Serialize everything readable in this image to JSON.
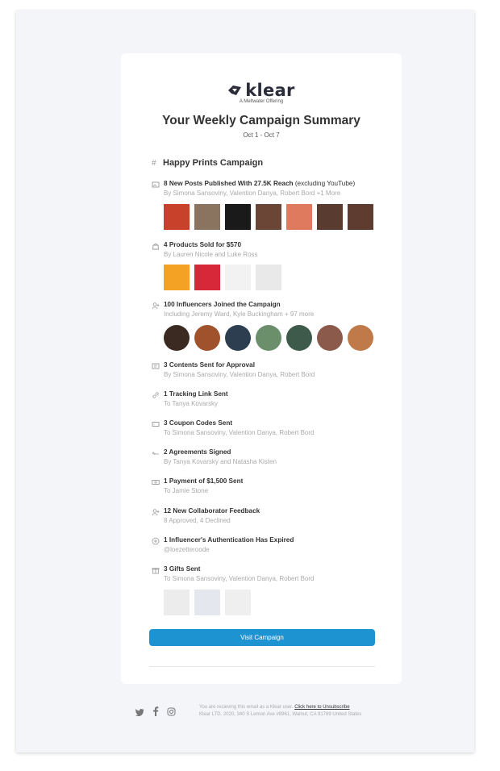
{
  "brand": {
    "name": "klear",
    "tagline": "A Meltwater Offering"
  },
  "email": {
    "title": "Your Weekly Campaign Summary",
    "dates": "Oct 1 - Oct 7"
  },
  "campaign": {
    "name": "Happy Prints Campaign"
  },
  "items": [
    {
      "icon": "image-icon",
      "title": "8 New Posts Published With 27.5K Reach",
      "title_extra": "(excluding YouTube)",
      "subtitle": "By Simona Sansoviny, Valention Danya, Robert Bord +1 More"
    },
    {
      "icon": "shopping-bag-icon",
      "title": "4 Products Sold for $570",
      "subtitle": "By Lauren Nicole and Luke Ross"
    },
    {
      "icon": "user-add-icon",
      "title": "100 Influencers Joined the Campaign",
      "subtitle": "Including Jeremy Ward, Kyle Buckingham  + 97 more"
    },
    {
      "icon": "content-icon",
      "title": "3 Contents Sent for Approval",
      "subtitle": "By Simona Sansoviny, Valention Danya, Robert Bord"
    },
    {
      "icon": "link-icon",
      "title": "1 Tracking Link Sent",
      "subtitle": "To Tanya Kovarsky"
    },
    {
      "icon": "coupon-icon",
      "title": "3 Coupon Codes Sent",
      "subtitle": "To Simona Sansoviny, Valention Danya, Robert Bord"
    },
    {
      "icon": "signature-icon",
      "title": "2 Agreements Signed",
      "subtitle": "By Tanya Kovarsky and Natasha Kisten"
    },
    {
      "icon": "payment-icon",
      "title": "1 Payment of $1,500 Sent",
      "subtitle": "To Jamie Stone"
    },
    {
      "icon": "feedback-icon",
      "title": "12 New Collaborator Feedback",
      "subtitle": "8 Approved, 4 Declined"
    },
    {
      "icon": "plus-circle-icon",
      "title": "1 Influencer's Authentication Has Expired",
      "subtitle": "@loezetteroode"
    },
    {
      "icon": "gift-icon",
      "title": "3 Gifts Sent",
      "subtitle": "To Simona Sansoviny, Valention Danya, Robert Bord"
    }
  ],
  "post_thumbs": [
    "#c8412b",
    "#8a7460",
    "#1a1a1a",
    "#6b4535",
    "#e07a5f",
    "#5a3b30",
    "#5e3c2f"
  ],
  "product_thumbs": [
    "#f4a224",
    "#d62839",
    "#f2f2f2",
    "#e9e9e9"
  ],
  "avatars": [
    "#3a2a22",
    "#a0522d",
    "#2c3e50",
    "#6b8e6b",
    "#3d5a4a",
    "#8b5a4a",
    "#c07a4a"
  ],
  "gift_thumbs": [
    "#ececec",
    "#e4e8ee",
    "#efefef"
  ],
  "cta": {
    "label": "Visit Campaign"
  },
  "footer": {
    "line1": "You are recieving this email as a Klear user.",
    "unsubscribe": "Click here to Unsubscribe",
    "line2": "Klear LTD. 2020, 340 S Lemon Ave #8961, Walnut, CA 91789 United States"
  },
  "colors": {
    "accent": "#1d93d2",
    "background": "#f3f5f9"
  }
}
